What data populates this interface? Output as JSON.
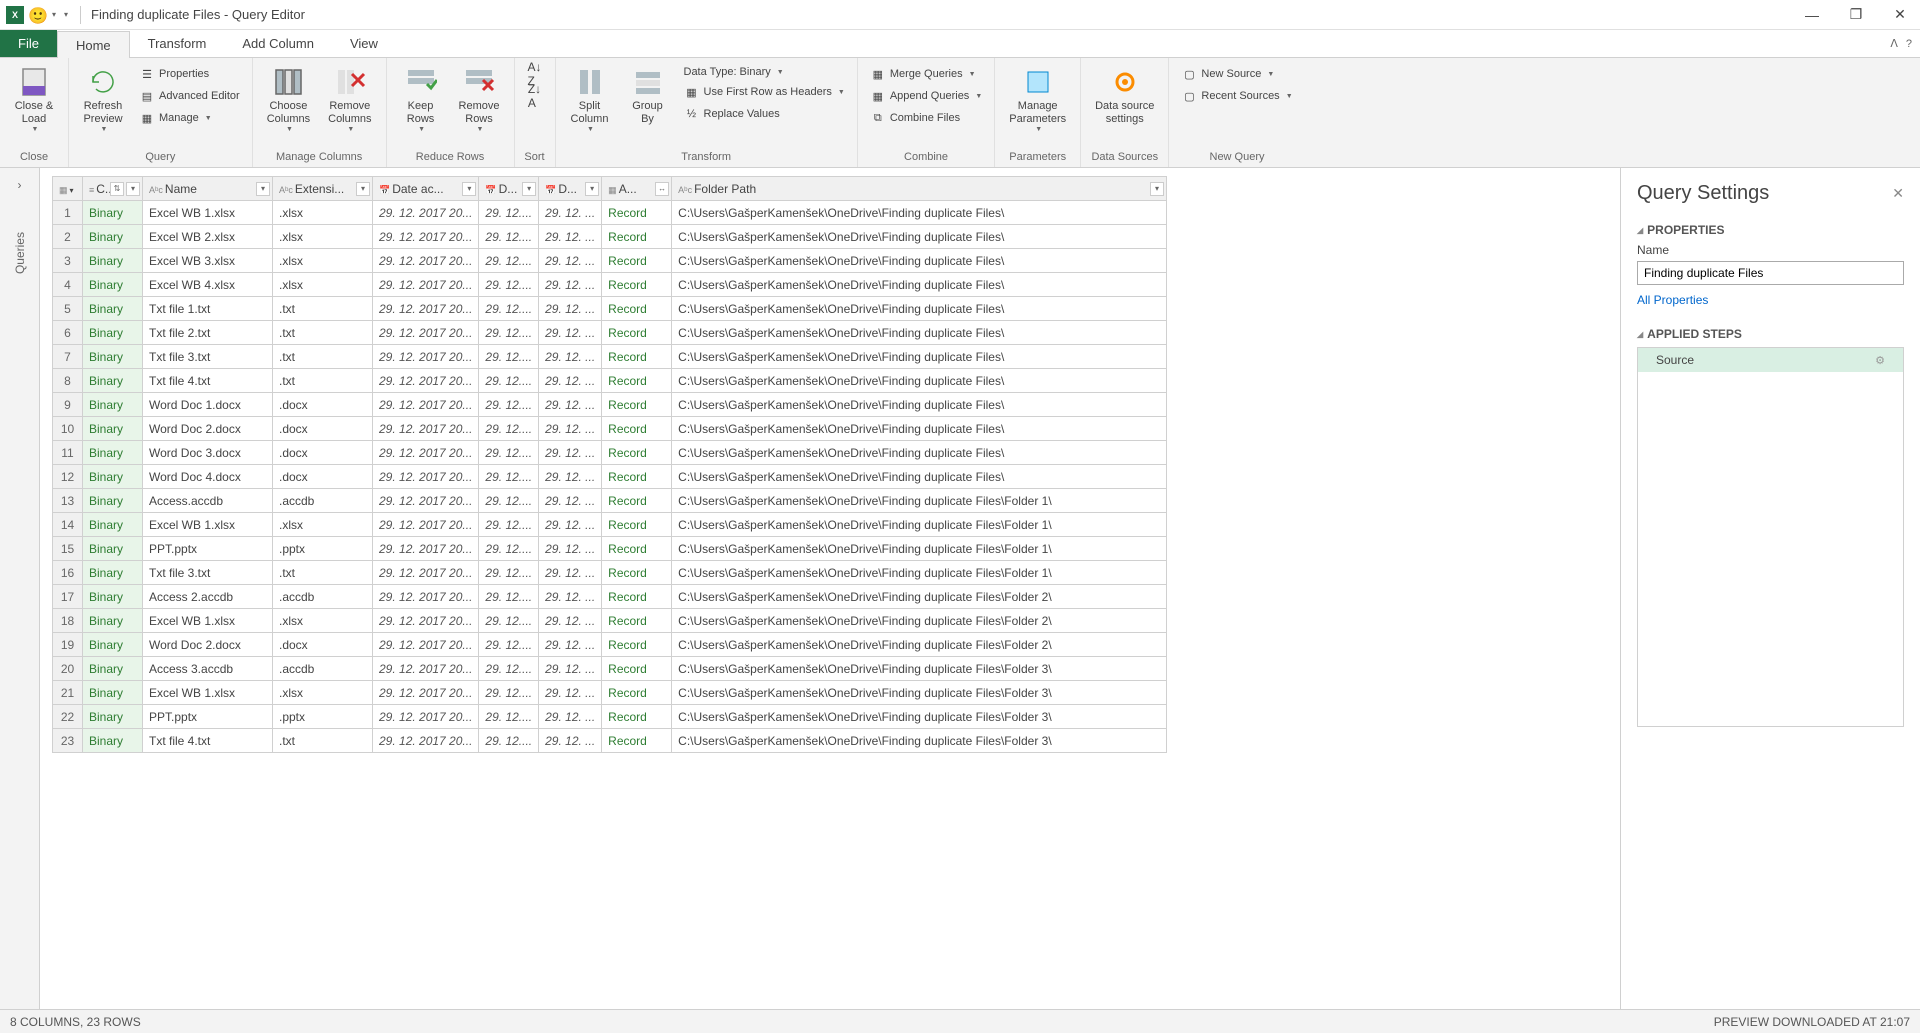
{
  "window": {
    "title": "Finding duplicate Files - Query Editor",
    "app_abbrev": "X",
    "smiley": "🙂"
  },
  "tabs": {
    "file": "File",
    "home": "Home",
    "transform": "Transform",
    "add_column": "Add Column",
    "view": "View"
  },
  "ribbon": {
    "close_load": "Close &\nLoad",
    "close_group": "Close",
    "refresh_preview": "Refresh\nPreview",
    "properties": "Properties",
    "advanced_editor": "Advanced Editor",
    "manage": "Manage",
    "query_group": "Query",
    "choose_columns": "Choose\nColumns",
    "remove_columns": "Remove\nColumns",
    "manage_columns_group": "Manage Columns",
    "keep_rows": "Keep\nRows",
    "remove_rows": "Remove\nRows",
    "reduce_rows_group": "Reduce Rows",
    "sort_group": "Sort",
    "split_column": "Split\nColumn",
    "group_by": "Group\nBy",
    "data_type": "Data Type: Binary",
    "first_row_headers": "Use First Row as Headers",
    "replace_values": "Replace Values",
    "transform_group": "Transform",
    "merge_queries": "Merge Queries",
    "append_queries": "Append Queries",
    "combine_files": "Combine Files",
    "combine_group": "Combine",
    "manage_parameters": "Manage\nParameters",
    "parameters_group": "Parameters",
    "data_source_settings": "Data source\nsettings",
    "data_sources_group": "Data Sources",
    "new_source": "New Source",
    "recent_sources": "Recent Sources",
    "new_query_group": "New Query"
  },
  "nav_rail": {
    "label": "Queries"
  },
  "columns": {
    "content": "C...",
    "name": "Name",
    "extension": "Extensi...",
    "date_accessed": "Date ac...",
    "date_modified": "D...",
    "date_created": "D...",
    "attributes": "A...",
    "folder_path": "Folder Path"
  },
  "rows": [
    {
      "n": "1",
      "content": "Binary",
      "name": "Excel WB 1.xlsx",
      "ext": ".xlsx",
      "da": "29. 12. 2017 20...",
      "dm": "29. 12....",
      "dc": "29. 12. ...",
      "attr": "Record",
      "path": "C:\\Users\\GašperKamenšek\\OneDrive\\Finding duplicate Files\\"
    },
    {
      "n": "2",
      "content": "Binary",
      "name": "Excel WB 2.xlsx",
      "ext": ".xlsx",
      "da": "29. 12. 2017 20...",
      "dm": "29. 12....",
      "dc": "29. 12. ...",
      "attr": "Record",
      "path": "C:\\Users\\GašperKamenšek\\OneDrive\\Finding duplicate Files\\"
    },
    {
      "n": "3",
      "content": "Binary",
      "name": "Excel WB 3.xlsx",
      "ext": ".xlsx",
      "da": "29. 12. 2017 20...",
      "dm": "29. 12....",
      "dc": "29. 12. ...",
      "attr": "Record",
      "path": "C:\\Users\\GašperKamenšek\\OneDrive\\Finding duplicate Files\\"
    },
    {
      "n": "4",
      "content": "Binary",
      "name": "Excel WB 4.xlsx",
      "ext": ".xlsx",
      "da": "29. 12. 2017 20...",
      "dm": "29. 12....",
      "dc": "29. 12. ...",
      "attr": "Record",
      "path": "C:\\Users\\GašperKamenšek\\OneDrive\\Finding duplicate Files\\"
    },
    {
      "n": "5",
      "content": "Binary",
      "name": "Txt file 1.txt",
      "ext": ".txt",
      "da": "29. 12. 2017 20...",
      "dm": "29. 12....",
      "dc": "29. 12. ...",
      "attr": "Record",
      "path": "C:\\Users\\GašperKamenšek\\OneDrive\\Finding duplicate Files\\"
    },
    {
      "n": "6",
      "content": "Binary",
      "name": "Txt file 2.txt",
      "ext": ".txt",
      "da": "29. 12. 2017 20...",
      "dm": "29. 12....",
      "dc": "29. 12. ...",
      "attr": "Record",
      "path": "C:\\Users\\GašperKamenšek\\OneDrive\\Finding duplicate Files\\"
    },
    {
      "n": "7",
      "content": "Binary",
      "name": "Txt file 3.txt",
      "ext": ".txt",
      "da": "29. 12. 2017 20...",
      "dm": "29. 12....",
      "dc": "29. 12. ...",
      "attr": "Record",
      "path": "C:\\Users\\GašperKamenšek\\OneDrive\\Finding duplicate Files\\"
    },
    {
      "n": "8",
      "content": "Binary",
      "name": "Txt file 4.txt",
      "ext": ".txt",
      "da": "29. 12. 2017 20...",
      "dm": "29. 12....",
      "dc": "29. 12. ...",
      "attr": "Record",
      "path": "C:\\Users\\GašperKamenšek\\OneDrive\\Finding duplicate Files\\"
    },
    {
      "n": "9",
      "content": "Binary",
      "name": "Word Doc 1.docx",
      "ext": ".docx",
      "da": "29. 12. 2017 20...",
      "dm": "29. 12....",
      "dc": "29. 12. ...",
      "attr": "Record",
      "path": "C:\\Users\\GašperKamenšek\\OneDrive\\Finding duplicate Files\\"
    },
    {
      "n": "10",
      "content": "Binary",
      "name": "Word Doc 2.docx",
      "ext": ".docx",
      "da": "29. 12. 2017 20...",
      "dm": "29. 12....",
      "dc": "29. 12. ...",
      "attr": "Record",
      "path": "C:\\Users\\GašperKamenšek\\OneDrive\\Finding duplicate Files\\"
    },
    {
      "n": "11",
      "content": "Binary",
      "name": "Word Doc 3.docx",
      "ext": ".docx",
      "da": "29. 12. 2017 20...",
      "dm": "29. 12....",
      "dc": "29. 12. ...",
      "attr": "Record",
      "path": "C:\\Users\\GašperKamenšek\\OneDrive\\Finding duplicate Files\\"
    },
    {
      "n": "12",
      "content": "Binary",
      "name": "Word Doc 4.docx",
      "ext": ".docx",
      "da": "29. 12. 2017 20...",
      "dm": "29. 12....",
      "dc": "29. 12. ...",
      "attr": "Record",
      "path": "C:\\Users\\GašperKamenšek\\OneDrive\\Finding duplicate Files\\"
    },
    {
      "n": "13",
      "content": "Binary",
      "name": "Access.accdb",
      "ext": ".accdb",
      "da": "29. 12. 2017 20...",
      "dm": "29. 12....",
      "dc": "29. 12. ...",
      "attr": "Record",
      "path": "C:\\Users\\GašperKamenšek\\OneDrive\\Finding duplicate Files\\Folder 1\\"
    },
    {
      "n": "14",
      "content": "Binary",
      "name": "Excel WB 1.xlsx",
      "ext": ".xlsx",
      "da": "29. 12. 2017 20...",
      "dm": "29. 12....",
      "dc": "29. 12. ...",
      "attr": "Record",
      "path": "C:\\Users\\GašperKamenšek\\OneDrive\\Finding duplicate Files\\Folder 1\\"
    },
    {
      "n": "15",
      "content": "Binary",
      "name": "PPT.pptx",
      "ext": ".pptx",
      "da": "29. 12. 2017 20...",
      "dm": "29. 12....",
      "dc": "29. 12. ...",
      "attr": "Record",
      "path": "C:\\Users\\GašperKamenšek\\OneDrive\\Finding duplicate Files\\Folder 1\\"
    },
    {
      "n": "16",
      "content": "Binary",
      "name": "Txt file 3.txt",
      "ext": ".txt",
      "da": "29. 12. 2017 20...",
      "dm": "29. 12....",
      "dc": "29. 12. ...",
      "attr": "Record",
      "path": "C:\\Users\\GašperKamenšek\\OneDrive\\Finding duplicate Files\\Folder 1\\"
    },
    {
      "n": "17",
      "content": "Binary",
      "name": "Access 2.accdb",
      "ext": ".accdb",
      "da": "29. 12. 2017 20...",
      "dm": "29. 12....",
      "dc": "29. 12. ...",
      "attr": "Record",
      "path": "C:\\Users\\GašperKamenšek\\OneDrive\\Finding duplicate Files\\Folder 2\\"
    },
    {
      "n": "18",
      "content": "Binary",
      "name": "Excel WB 1.xlsx",
      "ext": ".xlsx",
      "da": "29. 12. 2017 20...",
      "dm": "29. 12....",
      "dc": "29. 12. ...",
      "attr": "Record",
      "path": "C:\\Users\\GašperKamenšek\\OneDrive\\Finding duplicate Files\\Folder 2\\"
    },
    {
      "n": "19",
      "content": "Binary",
      "name": "Word Doc 2.docx",
      "ext": ".docx",
      "da": "29. 12. 2017 20...",
      "dm": "29. 12....",
      "dc": "29. 12. ...",
      "attr": "Record",
      "path": "C:\\Users\\GašperKamenšek\\OneDrive\\Finding duplicate Files\\Folder 2\\"
    },
    {
      "n": "20",
      "content": "Binary",
      "name": "Access 3.accdb",
      "ext": ".accdb",
      "da": "29. 12. 2017 20...",
      "dm": "29. 12....",
      "dc": "29. 12. ...",
      "attr": "Record",
      "path": "C:\\Users\\GašperKamenšek\\OneDrive\\Finding duplicate Files\\Folder 3\\"
    },
    {
      "n": "21",
      "content": "Binary",
      "name": "Excel WB 1.xlsx",
      "ext": ".xlsx",
      "da": "29. 12. 2017 20...",
      "dm": "29. 12....",
      "dc": "29. 12. ...",
      "attr": "Record",
      "path": "C:\\Users\\GašperKamenšek\\OneDrive\\Finding duplicate Files\\Folder 3\\"
    },
    {
      "n": "22",
      "content": "Binary",
      "name": "PPT.pptx",
      "ext": ".pptx",
      "da": "29. 12. 2017 20...",
      "dm": "29. 12....",
      "dc": "29. 12. ...",
      "attr": "Record",
      "path": "C:\\Users\\GašperKamenšek\\OneDrive\\Finding duplicate Files\\Folder 3\\"
    },
    {
      "n": "23",
      "content": "Binary",
      "name": "Txt file 4.txt",
      "ext": ".txt",
      "da": "29. 12. 2017 20...",
      "dm": "29. 12....",
      "dc": "29. 12. ...",
      "attr": "Record",
      "path": "C:\\Users\\GašperKamenšek\\OneDrive\\Finding duplicate Files\\Folder 3\\"
    }
  ],
  "settings": {
    "title": "Query Settings",
    "properties_hdr": "PROPERTIES",
    "name_label": "Name",
    "name_value": "Finding duplicate Files",
    "all_properties": "All Properties",
    "applied_steps_hdr": "APPLIED STEPS",
    "step_source": "Source"
  },
  "status": {
    "left": "8 COLUMNS, 23 ROWS",
    "right": "PREVIEW DOWNLOADED AT 21:07"
  }
}
